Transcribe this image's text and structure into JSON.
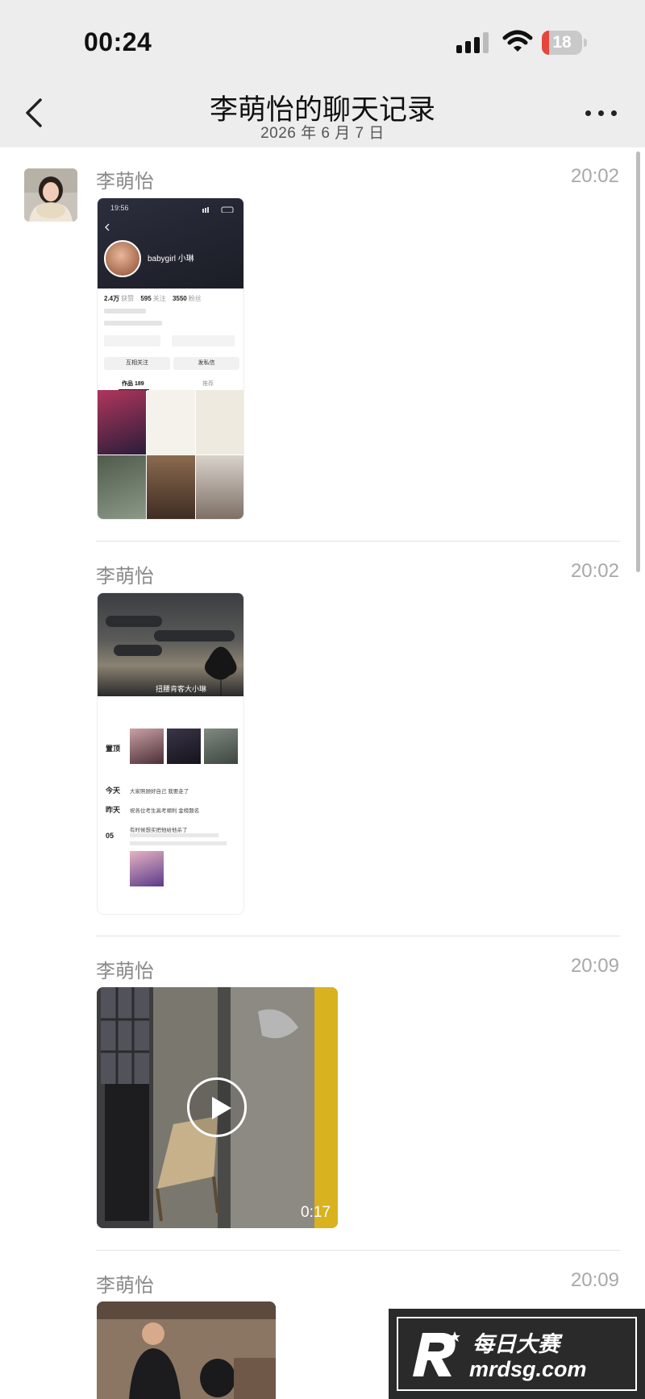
{
  "status_bar": {
    "time": "00:24",
    "battery_level": "18",
    "battery_fraction": 0.18,
    "signal_icon": "cellular-signal-icon",
    "wifi_icon": "wifi-icon"
  },
  "header": {
    "title": "李萌怡的聊天记录",
    "subtitle": "2026 年 6 月 7 日",
    "back_icon": "chevron-left-icon",
    "more_icon": "more-horizontal-icon"
  },
  "messages": [
    {
      "sender": "李萌怡",
      "time": "20:02",
      "type": "image",
      "content": {
        "status_time": "19:56",
        "username": "babygirl 小琳",
        "stats": [
          {
            "value": "2.4万",
            "label": "获赞"
          },
          {
            "value": "595",
            "label": "关注"
          },
          {
            "value": "3550",
            "label": "粉丝"
          }
        ],
        "buttons": [
          "互相关注",
          "发私信"
        ],
        "tabs": [
          "作品 189",
          "推荐"
        ]
      }
    },
    {
      "sender": "李萌怡",
      "time": "20:02",
      "type": "image",
      "content": {
        "nickname": "扭腰肯客大小琳",
        "rows": [
          {
            "label": "置顶",
            "text": ""
          },
          {
            "label": "今天",
            "text": "大家照顾好自己 我要走了"
          },
          {
            "label": "昨天",
            "text": "祝各位考生高考顺利 金榜题名"
          },
          {
            "label": "05",
            "text": "有时候想买把他给他杀了"
          }
        ]
      }
    },
    {
      "sender": "李萌怡",
      "time": "20:09",
      "type": "video",
      "duration": "0:17",
      "play_icon": "play-icon"
    },
    {
      "sender": "李萌怡",
      "time": "20:09",
      "type": "image"
    }
  ],
  "watermark": {
    "brand": "每日大赛",
    "url": "mrdsg.com"
  }
}
